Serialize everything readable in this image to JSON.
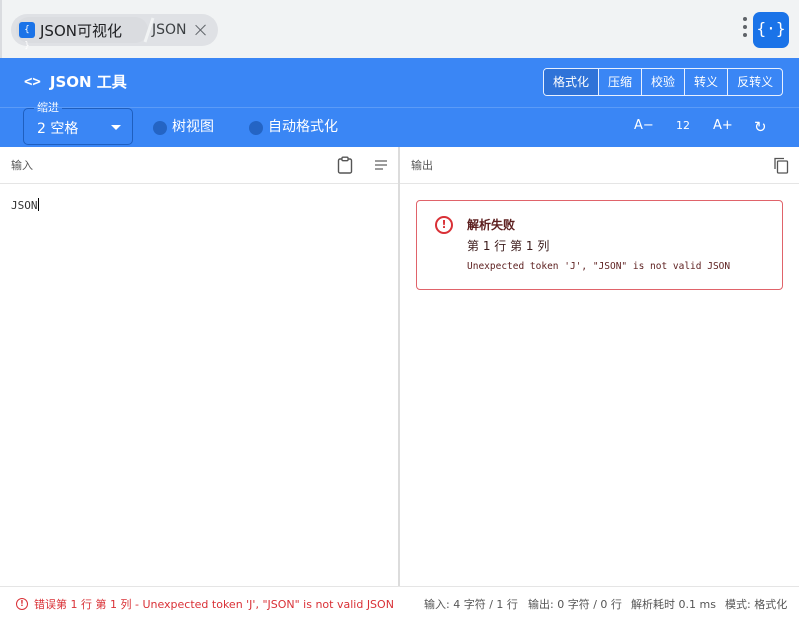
{
  "browser": {
    "tabs": [
      {
        "favicon": "{ }",
        "title": "JSON可视化",
        "active": true
      },
      {
        "title": "JSON",
        "active": false
      }
    ],
    "extension_icon": "{·}"
  },
  "header": {
    "title": "JSON 工具",
    "modes": [
      "格式化",
      "压缩",
      "校验",
      "转义",
      "反转义"
    ],
    "active_mode": "格式化"
  },
  "toolbar": {
    "indent_label": "缩进",
    "indent_value": "2 空格",
    "tree_view_label": "树视图",
    "auto_format_label": "自动格式化",
    "font_decrease": "A−",
    "font_size": "12",
    "font_increase": "A+",
    "refresh_glyph": "↻"
  },
  "input_pane": {
    "label": "输入",
    "content": "JSON"
  },
  "output_pane": {
    "label": "输出",
    "error": {
      "title": "解析失败",
      "position": "第 1 行 第 1 列",
      "message": "Unexpected token 'J', \"JSON\" is not valid JSON"
    }
  },
  "status": {
    "error": "错误第 1 行 第 1 列 - Unexpected token 'J', \"JSON\" is not valid JSON",
    "input_stats": "输入: 4 字符 / 1 行",
    "output_stats": "输出: 0 字符 / 0 行",
    "parse_time": "解析耗时 0.1 ms",
    "mode": "模式: 格式化"
  },
  "colors": {
    "header_blue": "#3a86f5",
    "error_red": "#d93036",
    "tab_bar": "#f1f3f4"
  }
}
